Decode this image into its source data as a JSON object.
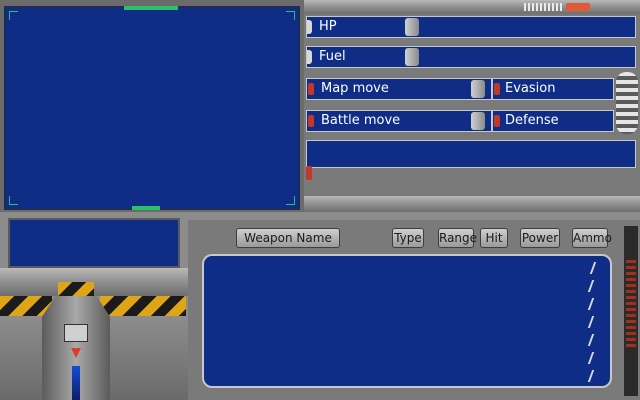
{
  "stats": {
    "hp_label": "HP",
    "fuel_label": "Fuel",
    "map_move_label": "Map move",
    "evasion_label": "Evasion",
    "battle_move_label": "Battle move",
    "defense_label": "Defense"
  },
  "weapon_table": {
    "columns": [
      "Weapon Name",
      "Type",
      "Range",
      "Hit",
      "Power",
      "Ammo"
    ]
  },
  "colors": {
    "screen": "#0f2d86",
    "frame_accent": "#27c26a",
    "metal": "#8c8c8c",
    "hazard_yellow": "#e0a516",
    "alert_red": "#c0392b"
  },
  "icons": [
    "signal-meter-icon",
    "alert-indicator-icon",
    "down-arrow-icon",
    "coil-icon"
  ]
}
